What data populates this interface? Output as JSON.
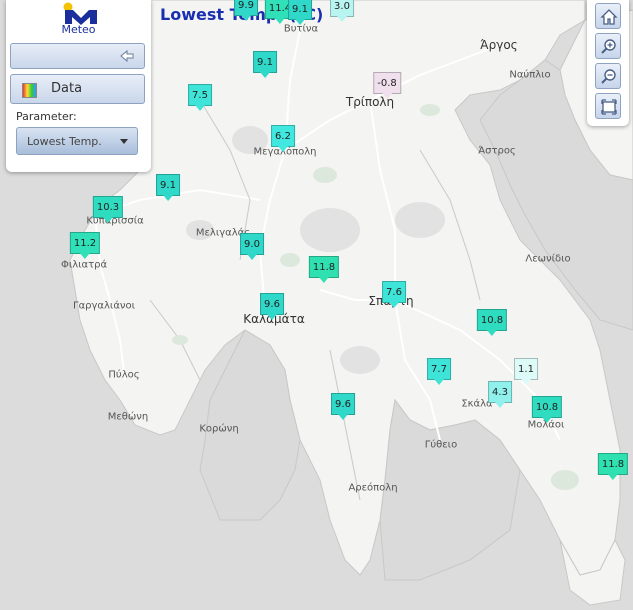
{
  "title": "Lowest Temp. (°C)",
  "panel": {
    "logo_text": "Meteo",
    "data_label": "Data",
    "parameter_label": "Parameter:",
    "parameter_value": "Lowest Temp."
  },
  "toolbar": {
    "icons": [
      "home-icon",
      "zoom-in-icon",
      "zoom-out-icon",
      "full-extent-icon"
    ]
  },
  "towns": [
    {
      "name": "Βυτίνα"
    },
    {
      "name": "Άργος"
    },
    {
      "name": "Ναύπλιο"
    },
    {
      "name": "Τρίπολη"
    },
    {
      "name": "Μεγαλόπολη"
    },
    {
      "name": "Άστρος"
    },
    {
      "name": "Κυπαρισσία"
    },
    {
      "name": "Μελιγαλάς"
    },
    {
      "name": "Φιλιατρά"
    },
    {
      "name": "Λεωνίδιο"
    },
    {
      "name": "Γαργαλιάνοι"
    },
    {
      "name": "Σπάρτη"
    },
    {
      "name": "Καλαμάτα"
    },
    {
      "name": "Πύλος"
    },
    {
      "name": "Σκάλα"
    },
    {
      "name": "Μολάοι"
    },
    {
      "name": "Μεθώνη"
    },
    {
      "name": "Κορώνη"
    },
    {
      "name": "Γύθειο"
    },
    {
      "name": "Αρεόπολη"
    }
  ],
  "stations": [
    {
      "value": "9.9",
      "color": "#2fd8c8"
    },
    {
      "value": "11.4",
      "color": "#2fe0b8"
    },
    {
      "value": "9.1",
      "color": "#2fd8c8"
    },
    {
      "value": "3.0",
      "color": "#b8f4f0"
    },
    {
      "value": "-0.8",
      "color": "#f0e0ee"
    },
    {
      "value": "9.1",
      "color": "#2fd8c8"
    },
    {
      "value": "7.5",
      "color": "#3ee4d8"
    },
    {
      "value": "6.2",
      "color": "#40e8e0"
    },
    {
      "value": "9.1",
      "color": "#2fd8c8"
    },
    {
      "value": "10.3",
      "color": "#2fdcc0"
    },
    {
      "value": "11.2",
      "color": "#2fe0b8"
    },
    {
      "value": "9.0",
      "color": "#2fd8c8"
    },
    {
      "value": "11.8",
      "color": "#2fe0b0"
    },
    {
      "value": "7.6",
      "color": "#3ee4d8"
    },
    {
      "value": "9.6",
      "color": "#2fd8c8"
    },
    {
      "value": "10.8",
      "color": "#2fdcc0"
    },
    {
      "value": "7.7",
      "color": "#3ee4d8"
    },
    {
      "value": "1.1",
      "color": "#dcfaf8"
    },
    {
      "value": "4.3",
      "color": "#90f0ec"
    },
    {
      "value": "10.8",
      "color": "#2fdcc0"
    },
    {
      "value": "9.6",
      "color": "#2fd8c8"
    },
    {
      "value": "11.8",
      "color": "#2fe0b0"
    }
  ]
}
